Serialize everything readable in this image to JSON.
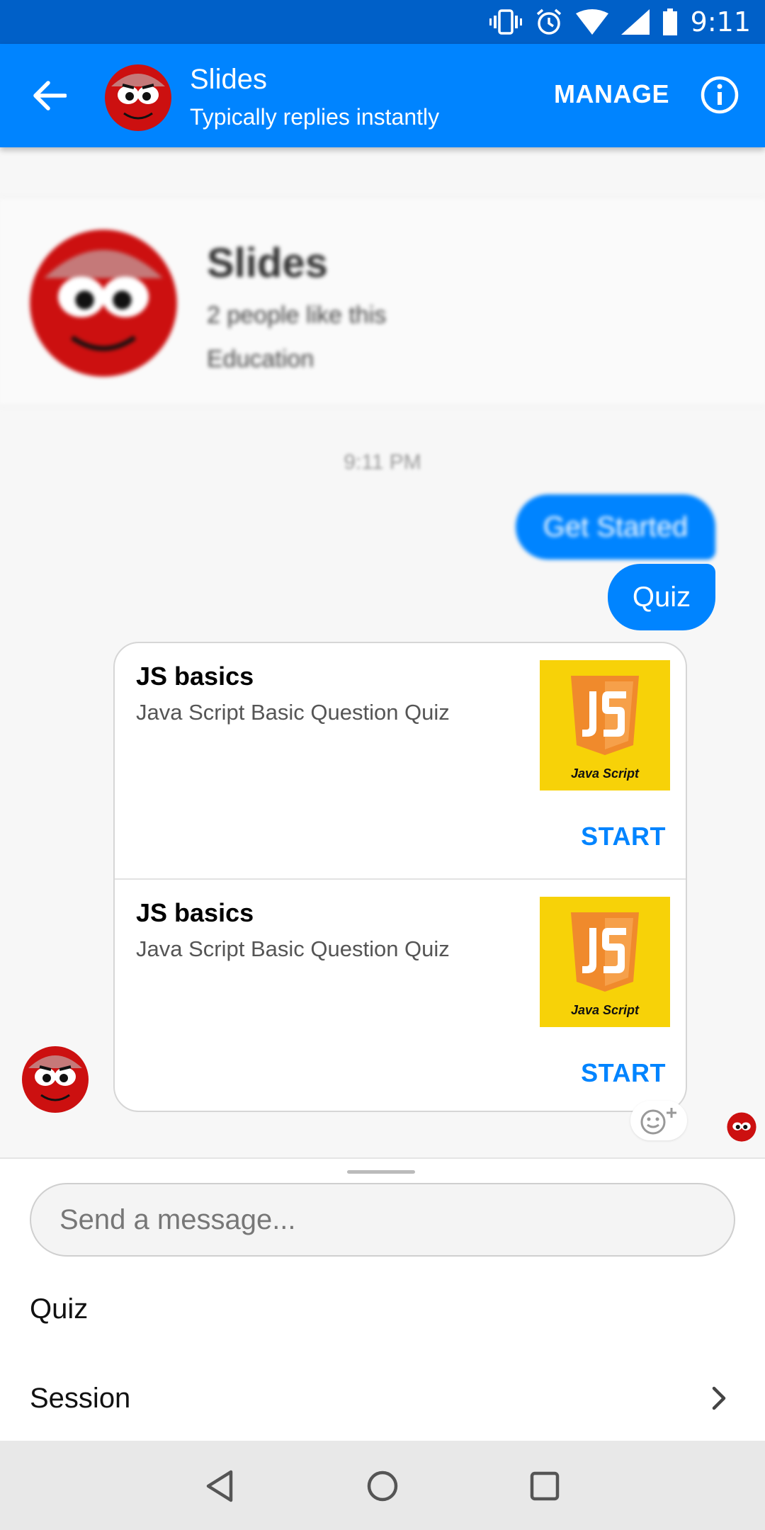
{
  "status_bar": {
    "time": "9:11"
  },
  "header": {
    "title": "Slides",
    "subtitle": "Typically replies instantly",
    "manage_label": "MANAGE"
  },
  "profile": {
    "name": "Slides",
    "likes": "2 people like this",
    "category": "Education"
  },
  "conversation": {
    "timestamp": "9:11 PM",
    "sent_messages": [
      "Get Started",
      "Quiz"
    ],
    "cards": [
      {
        "title": "JS basics",
        "subtitle": "Java Script Basic Question Quiz",
        "image_caption": "Java Script",
        "button": "START"
      },
      {
        "title": "JS basics",
        "subtitle": "Java Script Basic Question Quiz",
        "image_caption": "Java Script",
        "button": "START"
      }
    ]
  },
  "composer": {
    "placeholder": "Send a message...",
    "quick_replies": [
      "Quiz",
      "Session"
    ]
  },
  "colors": {
    "primary": "#0084ff",
    "status_bar": "#0060c8",
    "js_yellow": "#f7d208",
    "js_orange": "#f08a2c"
  },
  "icons": [
    "back-arrow-icon",
    "info-icon",
    "vibrate-icon",
    "alarm-icon",
    "wifi-icon",
    "signal-icon",
    "battery-icon",
    "emoji-add-icon",
    "chevron-right-icon",
    "nav-back-icon",
    "nav-home-icon",
    "nav-recents-icon"
  ]
}
